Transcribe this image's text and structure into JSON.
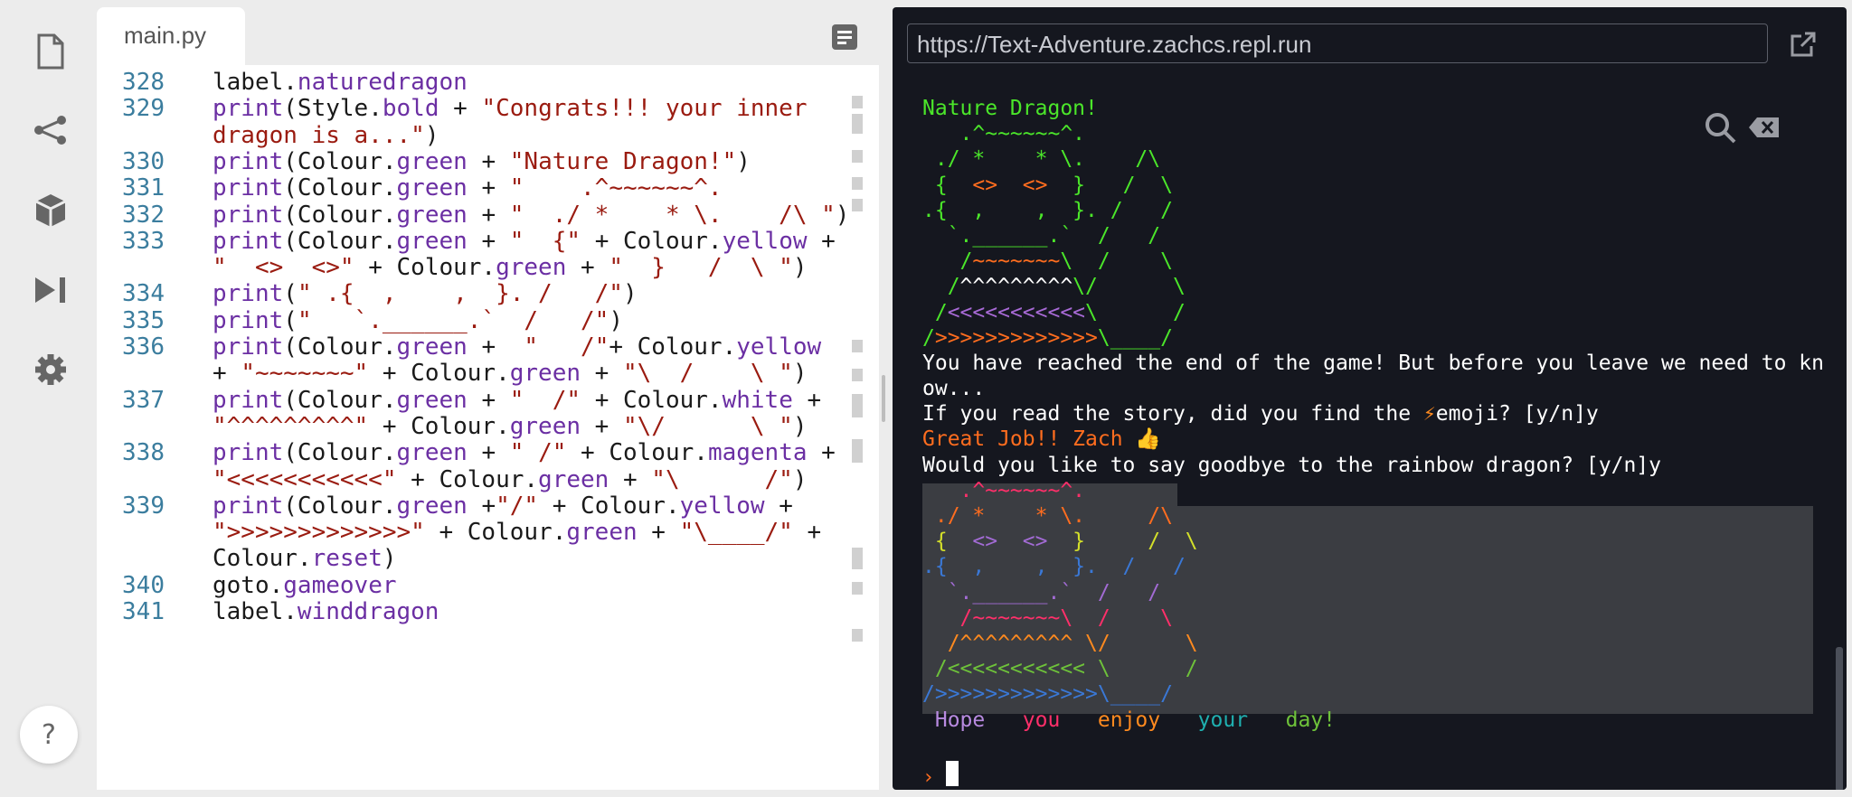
{
  "sidebar": {
    "icons": [
      "files-icon",
      "share-icon",
      "packages-icon",
      "run-icon",
      "settings-icon"
    ],
    "help_label": "?"
  },
  "editor": {
    "tab_label": "main.py",
    "lines": [
      {
        "n": "328",
        "parts": [
          [
            "p",
            "label."
          ],
          [
            "i",
            "naturedragon"
          ]
        ]
      },
      {
        "n": "329",
        "parts": [
          [
            "i",
            "print"
          ],
          [
            "p",
            "(Style."
          ],
          [
            "i",
            "bold"
          ],
          [
            "p",
            " + "
          ],
          [
            "s",
            "\"Congrats!!! your inner"
          ]
        ]
      },
      {
        "n": "",
        "parts": [
          [
            "s",
            "dragon is a...\""
          ],
          [
            "p",
            ")"
          ]
        ]
      },
      {
        "n": "330",
        "parts": [
          [
            "i",
            "print"
          ],
          [
            "p",
            "(Colour."
          ],
          [
            "i",
            "green"
          ],
          [
            "p",
            " + "
          ],
          [
            "s",
            "\"Nature Dragon!\""
          ],
          [
            "p",
            ")"
          ]
        ]
      },
      {
        "n": "331",
        "parts": [
          [
            "i",
            "print"
          ],
          [
            "p",
            "(Colour."
          ],
          [
            "i",
            "green"
          ],
          [
            "p",
            " + "
          ],
          [
            "s",
            "\"    .^~~~~~~^.         \""
          ],
          [
            "p",
            ")"
          ]
        ]
      },
      {
        "n": "332",
        "parts": [
          [
            "i",
            "print"
          ],
          [
            "p",
            "(Colour."
          ],
          [
            "i",
            "green"
          ],
          [
            "p",
            " + "
          ],
          [
            "s",
            "\"  ./ *    * \\.    /\\ \""
          ],
          [
            "p",
            ")"
          ]
        ]
      },
      {
        "n": "333",
        "parts": [
          [
            "i",
            "print"
          ],
          [
            "p",
            "(Colour."
          ],
          [
            "i",
            "green"
          ],
          [
            "p",
            " + "
          ],
          [
            "s",
            "\"  {\""
          ],
          [
            "p",
            " + Colour."
          ],
          [
            "i",
            "yellow"
          ],
          [
            "p",
            " +"
          ]
        ]
      },
      {
        "n": "",
        "parts": [
          [
            "s",
            "\"  <>  <>\""
          ],
          [
            "p",
            " + Colour."
          ],
          [
            "i",
            "green"
          ],
          [
            "p",
            " + "
          ],
          [
            "s",
            "\"  }   /  \\ \""
          ],
          [
            "p",
            ")"
          ]
        ]
      },
      {
        "n": "334",
        "parts": [
          [
            "i",
            "print"
          ],
          [
            "p",
            "("
          ],
          [
            "s",
            "\" .{  ,    ,  }. /   /\""
          ],
          [
            "p",
            ")"
          ]
        ]
      },
      {
        "n": "335",
        "parts": [
          [
            "i",
            "print"
          ],
          [
            "p",
            "("
          ],
          [
            "s",
            "\"   `.______.`  /   /\""
          ],
          [
            "p",
            ")"
          ]
        ]
      },
      {
        "n": "336",
        "parts": [
          [
            "i",
            "print"
          ],
          [
            "p",
            "(Colour."
          ],
          [
            "i",
            "green"
          ],
          [
            "p",
            " +  "
          ],
          [
            "s",
            "\"   /\""
          ],
          [
            "p",
            "+ Colour."
          ],
          [
            "i",
            "yellow"
          ]
        ]
      },
      {
        "n": "",
        "parts": [
          [
            "p",
            "+ "
          ],
          [
            "s",
            "\"~~~~~~~\""
          ],
          [
            "p",
            " + Colour."
          ],
          [
            "i",
            "green"
          ],
          [
            "p",
            " + "
          ],
          [
            "s",
            "\"\\  /    \\ \""
          ],
          [
            "p",
            ")"
          ]
        ]
      },
      {
        "n": "337",
        "parts": [
          [
            "i",
            "print"
          ],
          [
            "p",
            "(Colour."
          ],
          [
            "i",
            "green"
          ],
          [
            "p",
            " + "
          ],
          [
            "s",
            "\"  /\""
          ],
          [
            "p",
            " + Colour."
          ],
          [
            "i",
            "white"
          ],
          [
            "p",
            " +"
          ]
        ]
      },
      {
        "n": "",
        "parts": [
          [
            "s",
            "\"^^^^^^^^^\""
          ],
          [
            "p",
            " + Colour."
          ],
          [
            "i",
            "green"
          ],
          [
            "p",
            " + "
          ],
          [
            "s",
            "\"\\/      \\ \""
          ],
          [
            "p",
            ")"
          ]
        ]
      },
      {
        "n": "338",
        "parts": [
          [
            "i",
            "print"
          ],
          [
            "p",
            "(Colour."
          ],
          [
            "i",
            "green"
          ],
          [
            "p",
            " + "
          ],
          [
            "s",
            "\" /\""
          ],
          [
            "p",
            " + Colour."
          ],
          [
            "i",
            "magenta"
          ],
          [
            "p",
            " +"
          ]
        ]
      },
      {
        "n": "",
        "parts": [
          [
            "s",
            "\"<<<<<<<<<<<\""
          ],
          [
            "p",
            " + Colour."
          ],
          [
            "i",
            "green"
          ],
          [
            "p",
            " + "
          ],
          [
            "s",
            "\"\\      /\""
          ],
          [
            "p",
            ")"
          ]
        ]
      },
      {
        "n": "339",
        "parts": [
          [
            "i",
            "print"
          ],
          [
            "p",
            "(Colour."
          ],
          [
            "i",
            "green"
          ],
          [
            "p",
            " +"
          ],
          [
            "s",
            "\"/\""
          ],
          [
            "p",
            " + Colour."
          ],
          [
            "i",
            "yellow"
          ],
          [
            "p",
            " +"
          ]
        ]
      },
      {
        "n": "",
        "parts": [
          [
            "s",
            "\">>>>>>>>>>>>>\""
          ],
          [
            "p",
            " + Colour."
          ],
          [
            "i",
            "green"
          ],
          [
            "p",
            " + "
          ],
          [
            "s",
            "\"\\____/\""
          ],
          [
            "p",
            " +"
          ]
        ]
      },
      {
        "n": "",
        "parts": [
          [
            "p",
            "Colour."
          ],
          [
            "i",
            "reset"
          ],
          [
            "p",
            ")"
          ]
        ]
      },
      {
        "n": "340",
        "parts": [
          [
            "p",
            "goto."
          ],
          [
            "i",
            "gameover"
          ]
        ]
      },
      {
        "n": "341",
        "parts": [
          [
            "p",
            "label."
          ],
          [
            "i",
            "winddragon"
          ]
        ]
      }
    ]
  },
  "webview": {
    "url": "https://Text-Adventure.zachcs.repl.run",
    "terminal": [
      [
        [
          "green",
          "Nature Dragon!"
        ]
      ],
      [
        [
          "green",
          "   .^~~~~~~^."
        ]
      ],
      [
        [
          "green",
          " ./ *    * \\.    /\\"
        ]
      ],
      [
        [
          "green",
          " {  "
        ],
        [
          "orange",
          "<>  <>"
        ],
        [
          "green",
          "  }   /  \\"
        ]
      ],
      [
        [
          "green",
          ".{  ,    ,  }. /   /"
        ]
      ],
      [
        [
          "green",
          "  `.______.`  /   /"
        ]
      ],
      [
        [
          "green",
          "   /"
        ],
        [
          "orange",
          "~~~~~~~"
        ],
        [
          "green",
          "\\  /    \\"
        ]
      ],
      [
        [
          "green",
          "  /"
        ],
        [
          "white",
          "^^^^^^^^^"
        ],
        [
          "green",
          "\\/      \\"
        ]
      ],
      [
        [
          "green",
          " /"
        ],
        [
          "magenta",
          "<<<<<<<<<<<"
        ],
        [
          "green",
          "\\      /"
        ]
      ],
      [
        [
          "green",
          "/"
        ],
        [
          "orange",
          ">>>>>>>>>>>>>"
        ],
        [
          "green",
          "\\____/"
        ]
      ],
      [
        [
          "white",
          "You have reached the end of the game! But before you leave we need to kn"
        ]
      ],
      [
        [
          "white",
          "ow..."
        ]
      ],
      [
        [
          "white",
          "If you read the story, did you find the "
        ],
        [
          "ora",
          "⚡"
        ],
        [
          "white",
          "emoji? [y/n]y"
        ]
      ],
      [
        [
          "orange",
          "Great Job!! Zach 👍"
        ]
      ],
      [
        [
          "white",
          "Would you like to say goodbye to the rainbow dragon? [y/n]y"
        ]
      ],
      [
        [
          "rb1",
          "   .^~~~~~~^."
        ]
      ],
      [
        [
          "orange",
          " ./ *    * \\."
        ],
        [
          "orange",
          "     /\\"
        ]
      ],
      [
        [
          "yellow2",
          " {  "
        ],
        [
          "purp",
          "<>  <>"
        ],
        [
          "yellow2",
          "  }     /  \\"
        ]
      ],
      [
        [
          "blue",
          ".{  ,    ,  }.  /   /"
        ]
      ],
      [
        [
          "purp",
          "  `.______.`  /   /"
        ]
      ],
      [
        [
          "pink",
          "   /~~~~~~~\\  /    \\"
        ]
      ],
      [
        [
          "ora",
          "  /^^^^^^^^^ \\/      \\"
        ]
      ],
      [
        [
          "lime",
          " /<<<<<<<<<<< \\      /"
        ]
      ],
      [
        [
          "blue",
          "/>>>>>>>>>>>>>\\____/"
        ]
      ],
      [
        [
          "lav",
          " Hope "
        ],
        [
          "pink",
          "  you "
        ],
        [
          "ora",
          "  enjoy "
        ],
        [
          "teal",
          "  your "
        ],
        [
          "lime",
          "  day!"
        ]
      ]
    ],
    "prompt_symbol": "›"
  }
}
